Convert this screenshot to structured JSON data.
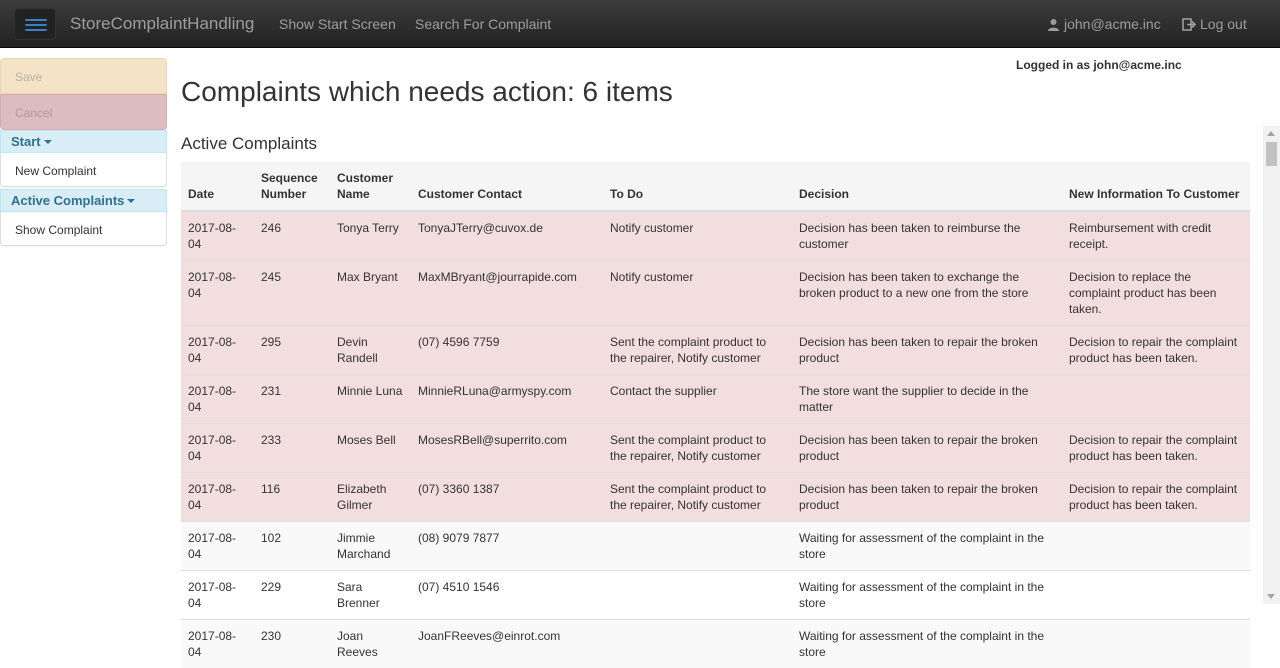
{
  "navbar": {
    "brand": "StoreComplaintHandling",
    "links": [
      "Show Start Screen",
      "Search For Complaint"
    ],
    "user": "john@acme.inc",
    "logout": "Log out"
  },
  "sidebar": {
    "save": "Save",
    "cancel": "Cancel",
    "groups": [
      {
        "label": "Start",
        "items": [
          "New Complaint"
        ]
      },
      {
        "label": "Active Complaints",
        "items": [
          "Show Complaint"
        ]
      }
    ]
  },
  "main": {
    "logged_in": "Logged in as john@acme.inc",
    "title": "Complaints which needs action: 6 items",
    "section": "Active Complaints",
    "table": {
      "headers": [
        "Date",
        "Sequence Number",
        "Customer Name",
        "Customer Contact",
        "To Do",
        "Decision",
        "New Information To Customer"
      ],
      "rows": [
        {
          "status": "action",
          "cells": [
            "2017-08-04",
            "246",
            "Tonya Terry",
            "TonyaJTerry@cuvox.de",
            "Notify customer",
            "Decision has been taken to reimburse the customer",
            "Reimbursement with credit receipt."
          ]
        },
        {
          "status": "action",
          "cells": [
            "2017-08-04",
            "245",
            "Max Bryant",
            "MaxMBryant@jourrapide.com",
            "Notify customer",
            "Decision has been taken to exchange the broken product to a new one from the store",
            "Decision to replace the complaint product has been taken."
          ]
        },
        {
          "status": "action",
          "cells": [
            "2017-08-04",
            "295",
            "Devin Randell",
            "(07) 4596 7759",
            "Sent the complaint product to the repairer, Notify customer",
            "Decision has been taken to repair the broken product",
            "Decision to repair the complaint product has been taken."
          ]
        },
        {
          "status": "action",
          "cells": [
            "2017-08-04",
            "231",
            "Minnie Luna",
            "MinnieRLuna@armyspy.com",
            "Contact the supplier",
            "The store want the supplier to decide in the matter",
            ""
          ]
        },
        {
          "status": "action",
          "cells": [
            "2017-08-04",
            "233",
            "Moses Bell",
            "MosesRBell@superrito.com",
            "Sent the complaint product to the repairer, Notify customer",
            "Decision has been taken to repair the broken product",
            "Decision to repair the complaint product has been taken."
          ]
        },
        {
          "status": "action",
          "cells": [
            "2017-08-04",
            "116",
            "Elizabeth Gilmer",
            "(07) 3360 1387",
            "Sent the complaint product to the repairer, Notify customer",
            "Decision has been taken to repair the broken product",
            "Decision to repair the complaint product has been taken."
          ]
        },
        {
          "status": "normal",
          "cells": [
            "2017-08-04",
            "102",
            "Jimmie Marchand",
            "(08) 9079 7877",
            "",
            "Waiting for assessment of the complaint in the store",
            ""
          ]
        },
        {
          "status": "normal",
          "cells": [
            "2017-08-04",
            "229",
            "Sara Brenner",
            "(07) 4510 1546",
            "",
            "Waiting for assessment of the complaint in the store",
            ""
          ]
        },
        {
          "status": "normal",
          "cells": [
            "2017-08-04",
            "230",
            "Joan Reeves",
            "JoanFReeves@einrot.com",
            "",
            "Waiting for assessment of the complaint in the store",
            ""
          ]
        }
      ]
    }
  },
  "colors": {
    "action_row": "#f2dede",
    "sidebar_head": "#d9edf7",
    "navbar": "#222222"
  }
}
